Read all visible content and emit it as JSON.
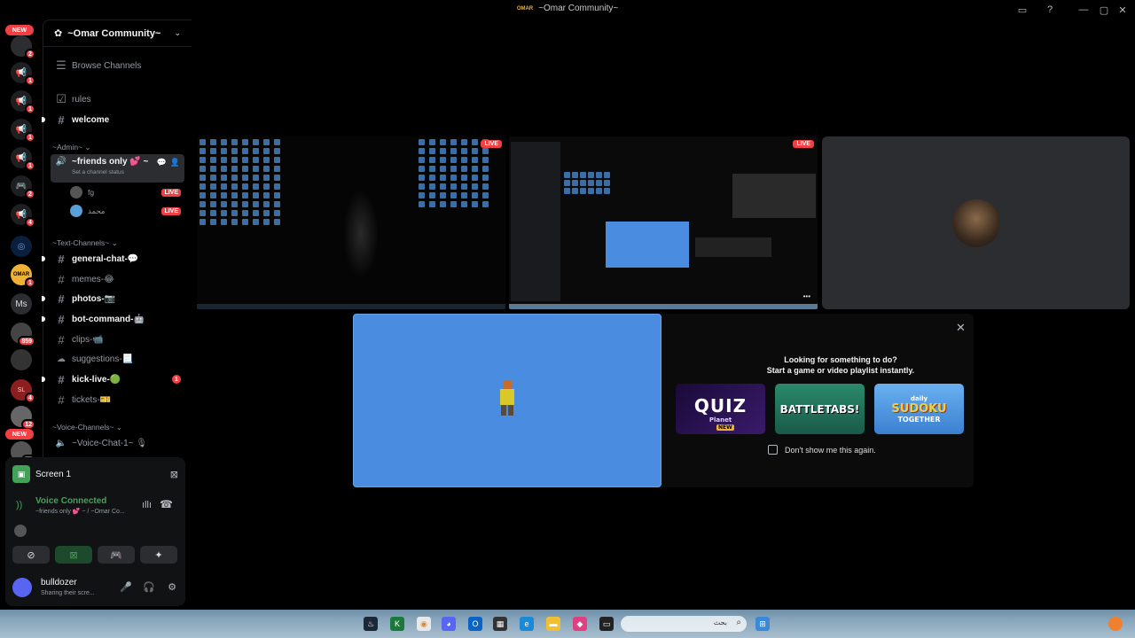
{
  "window": {
    "title": "~Omar Community~",
    "logo_text": "OMAR"
  },
  "rail": {
    "new_label": "NEW",
    "badges": [
      "2",
      "1",
      "1",
      "1",
      "1",
      "2",
      "4",
      "1",
      "859",
      "4",
      "12",
      "32"
    ],
    "ms_label": "Ms"
  },
  "server": {
    "name": "~Omar Community~"
  },
  "sidebar": {
    "browse": "Browse Channels",
    "rules": "rules",
    "welcome": "welcome",
    "cat_admin": "~Admin~",
    "friends": "~friends only 💕 ~",
    "status_hint": "Set a channel status",
    "voice_users": [
      {
        "name": "fg",
        "live": "LIVE"
      },
      {
        "name": "محمد",
        "live": "LIVE"
      }
    ],
    "cat_text": "~Text-Channels~",
    "channels": [
      {
        "name": "general-chat-💬",
        "bright": true
      },
      {
        "name": "memes-😂",
        "bright": false
      },
      {
        "name": "photos-📷",
        "bright": true
      },
      {
        "name": "bot-command-🤖",
        "bright": true
      },
      {
        "name": "clips-📹",
        "bright": false
      },
      {
        "name": "suggestions-📃",
        "bright": false
      },
      {
        "name": "kick-live-🟢",
        "bright": true
      },
      {
        "name": "tickets-🎫",
        "bright": false
      }
    ],
    "kick_mention": "1",
    "cat_voice": "~Voice-Channels~",
    "voice_chat": "~Voice-Chat-1~ 🎙"
  },
  "panel": {
    "screen_label": "Screen 1",
    "voice_connected": "Voice Connected",
    "voice_sub": "~friends only 💕 ~ / ~Omar Co...",
    "username": "bulldozer",
    "user_status": "Sharing their scre..."
  },
  "stage": {
    "live_label": "LIVE",
    "more": "•••"
  },
  "activity": {
    "title_line1": "Looking for something to do?",
    "title_line2": "Start a game or video playlist instantly.",
    "cards": [
      "QUIZ",
      "BATTLETABS!",
      "SUDOKU"
    ],
    "quiz_sub": "Planet",
    "quiz_new": "NEW",
    "sudoku_top": "daily",
    "sudoku_bottom": "TOGETHER",
    "dont_show": "Don't show me this again."
  },
  "taskbar": {
    "search_placeholder": "بحث"
  },
  "colors": {
    "accent": "#5865f2",
    "live": "#f23f43",
    "connected": "#43a25a",
    "activity_bg": "#4a8de0"
  }
}
